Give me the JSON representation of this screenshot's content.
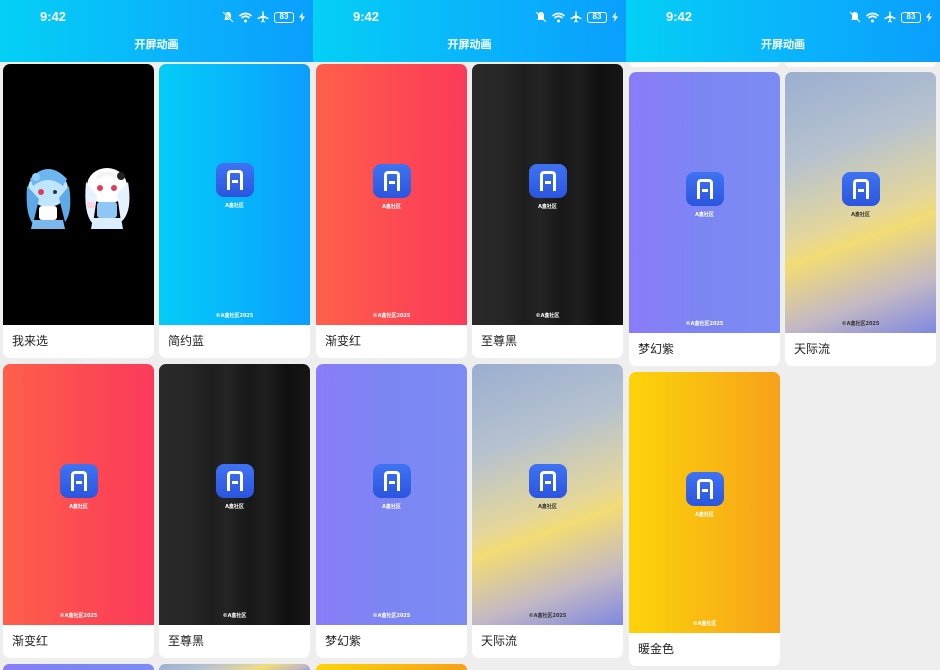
{
  "status": {
    "time": "9:42",
    "battery": "83"
  },
  "header": {
    "title": "开屏动画"
  },
  "brand": {
    "caption": "A盒社区",
    "footer_2025": "©A盒社区2025",
    "footer_short": "©A盒社区"
  },
  "options": {
    "pick": "我来选",
    "blue": "简约蓝",
    "gradient_red": "渐变红",
    "black": "至尊黑",
    "purple": "梦幻紫",
    "sky": "天际流",
    "gold": "暖金色"
  },
  "colors": {
    "header_start": "#04d0f5",
    "header_end": "#0a9ffd",
    "logo": "#2b55df"
  }
}
